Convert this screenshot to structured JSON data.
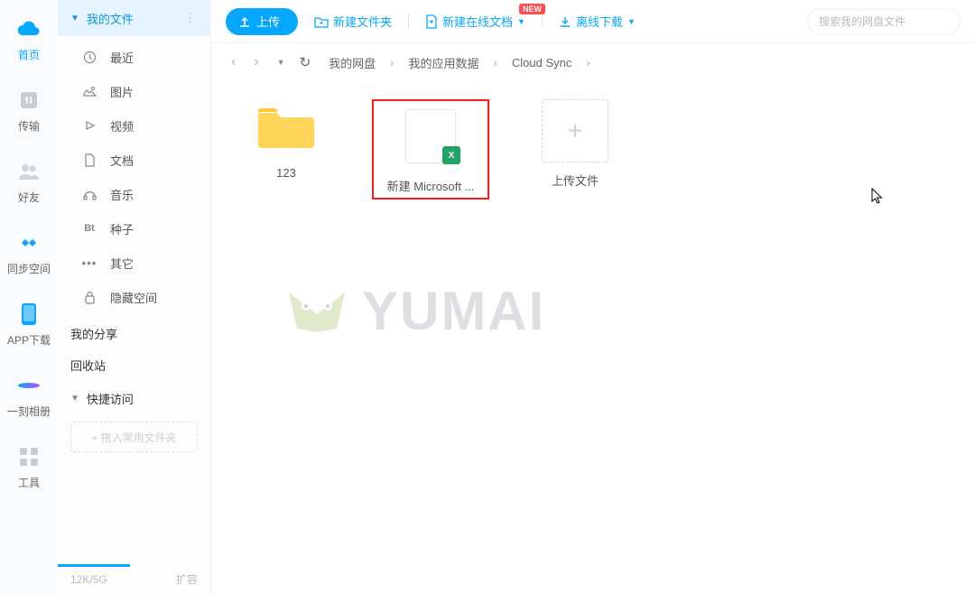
{
  "iconSidebar": [
    {
      "label": "首页",
      "icon": "cloud",
      "active": true
    },
    {
      "label": "传输",
      "icon": "transfer",
      "active": false
    },
    {
      "label": "好友",
      "icon": "friends",
      "active": false
    },
    {
      "label": "同步空间",
      "icon": "sync",
      "active": false
    },
    {
      "label": "APP下载",
      "icon": "app",
      "active": false
    },
    {
      "label": "一刻相册",
      "icon": "album",
      "active": false
    },
    {
      "label": "工具",
      "icon": "tools",
      "active": false
    }
  ],
  "catHeader": {
    "label": "我的文件",
    "more": "⋮"
  },
  "categories": [
    {
      "icon": "recent",
      "label": "最近"
    },
    {
      "icon": "image",
      "label": "图片"
    },
    {
      "icon": "video",
      "label": "视频"
    },
    {
      "icon": "doc",
      "label": "文档"
    },
    {
      "icon": "music",
      "label": "音乐"
    },
    {
      "icon": "bt",
      "label": "种子"
    },
    {
      "icon": "other",
      "label": "其它"
    },
    {
      "icon": "hidden",
      "label": "隐藏空间"
    }
  ],
  "sections": {
    "share": "我的分享",
    "recycle": "回收站"
  },
  "quick": {
    "label": "快捷访问",
    "dragHint": "+ 拖入常用文件夹"
  },
  "storage": {
    "used": "12K/5G",
    "expand": "扩容"
  },
  "toolbar": {
    "upload": "上传",
    "newFolder": "新建文件夹",
    "newDoc": "新建在线文档",
    "newBadge": "NEW",
    "offline": "离线下载"
  },
  "search": {
    "placeholder": "搜索我的网盘文件"
  },
  "breadcrumb": [
    "我的网盘",
    "我的应用数据",
    "Cloud Sync"
  ],
  "files": [
    {
      "type": "folder",
      "name": "123"
    },
    {
      "type": "excel",
      "name": "新建 Microsoft ...",
      "selected": true
    },
    {
      "type": "upload",
      "name": "上传文件"
    }
  ],
  "watermark": "YUMaI",
  "excelLetter": "X"
}
